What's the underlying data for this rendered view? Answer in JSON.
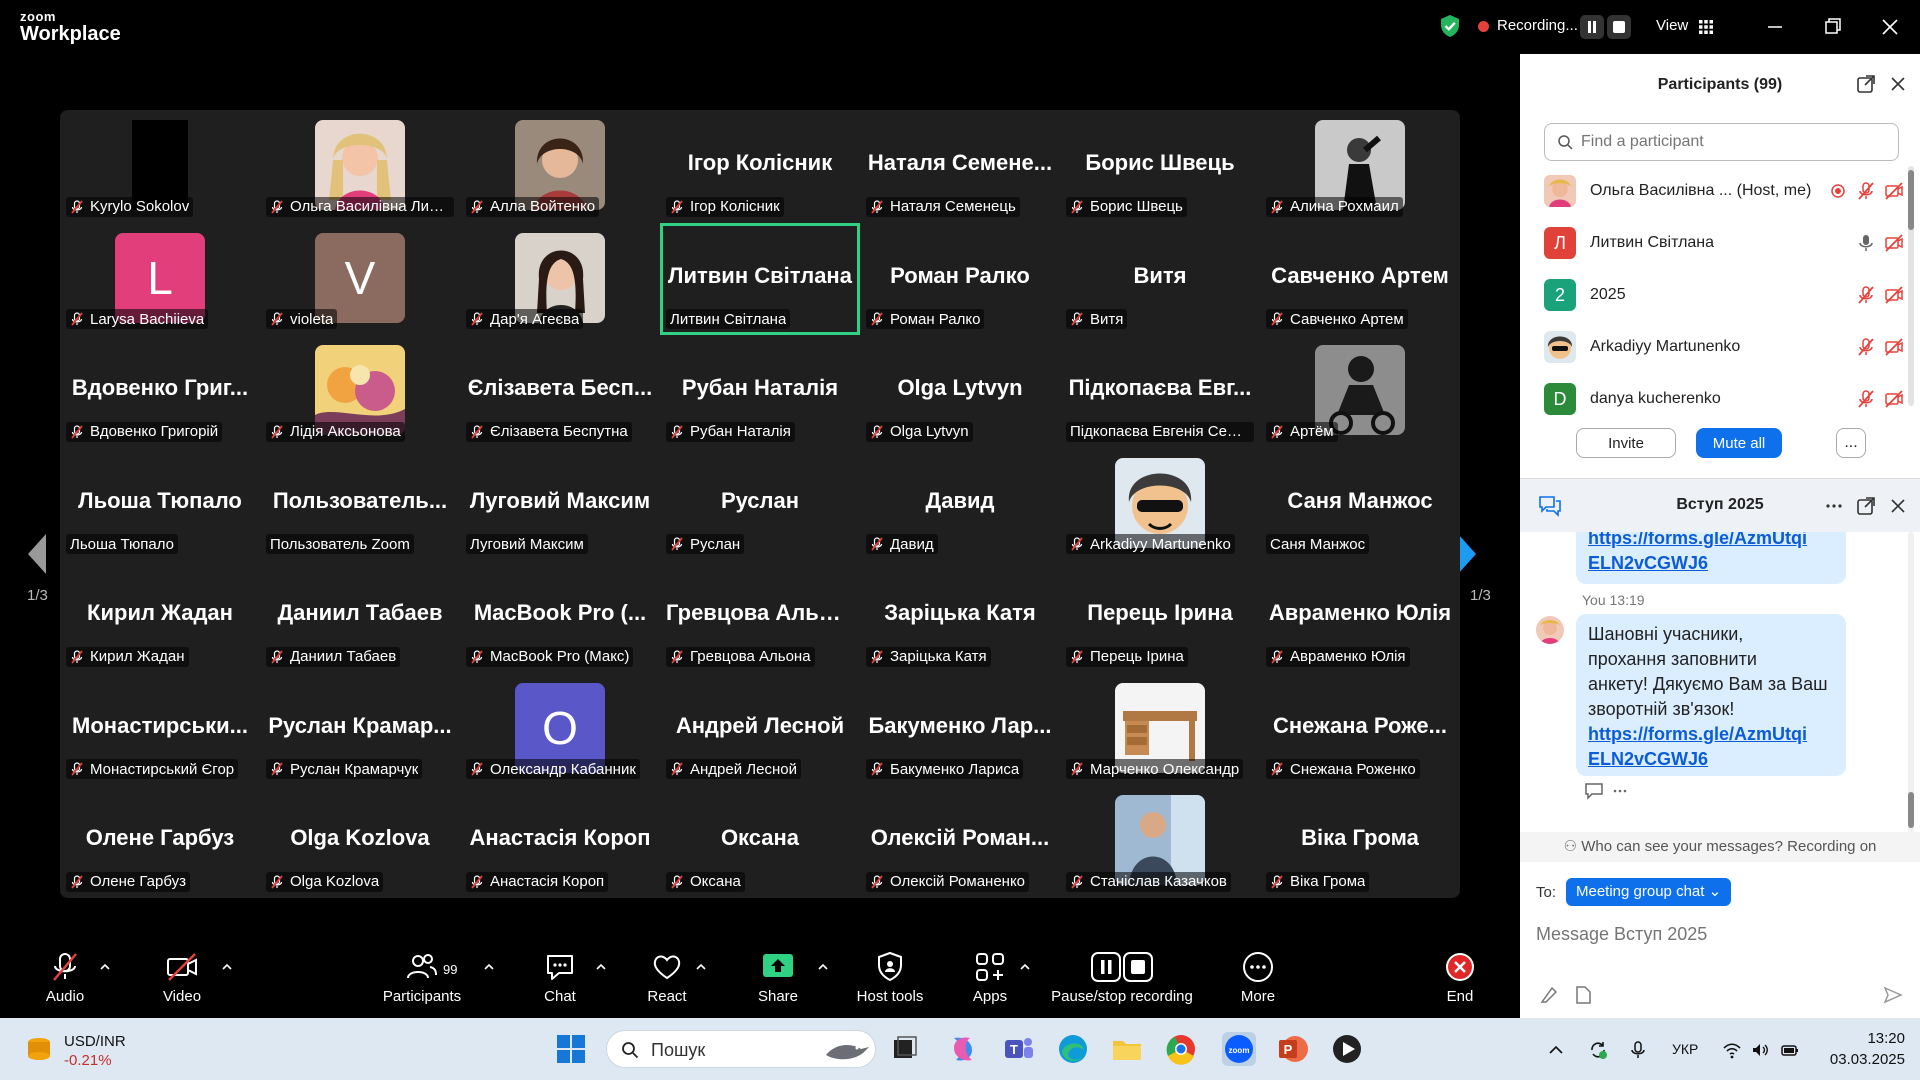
{
  "app": {
    "logo_top": "zoom",
    "logo_bottom": "Workplace"
  },
  "topbar": {
    "recording_label": "Recording...",
    "view_label": "View"
  },
  "gallery": {
    "page_indicator": "1/3",
    "tiles": [
      {
        "big": "",
        "name": "Kyrylo Sokolov",
        "avatar": "black"
      },
      {
        "big": "",
        "name": "Ольга Василівна Литв...",
        "avatar": "photo-blonde"
      },
      {
        "big": "",
        "name": "Алла Войтенко",
        "avatar": "photo-woman"
      },
      {
        "big": "Ігор Колісник",
        "name": "Ігор Колісник"
      },
      {
        "big": "Наталя Семене...",
        "name": "Наталя Семенець"
      },
      {
        "big": "Борис Швець",
        "name": "Борис Швець"
      },
      {
        "big": "",
        "name": "Алина Рохмаил",
        "avatar": "photo-dark"
      },
      {
        "big": "",
        "name": "Larysa Bachiieva",
        "letter": "L",
        "color": "#e23e7c"
      },
      {
        "big": "",
        "name": "violeta",
        "letter": "V",
        "color": "#8b6a60"
      },
      {
        "big": "",
        "name": "Дар'я Агеєва",
        "avatar": "photo-girl"
      },
      {
        "big": "Литвин Світлана",
        "name": "Литвин Світлана",
        "active": true,
        "nomic": true
      },
      {
        "big": "Роман Ралко",
        "name": "Роман Ралко"
      },
      {
        "big": "Витя",
        "name": "Витя"
      },
      {
        "big": "Савченко Артем",
        "name": "Савченко Артем"
      },
      {
        "big": "Вдовенко Григ...",
        "name": "Вдовенко Григорій"
      },
      {
        "big": "",
        "name": "Лідія Аксьонова",
        "avatar": "photo-art"
      },
      {
        "big": "Єлізавета Бесп...",
        "name": "Єлізавета Беспутна"
      },
      {
        "big": "Рубан Наталія",
        "name": "Рубан Наталія"
      },
      {
        "big": "Olga Lytvyn",
        "name": "Olga Lytvyn"
      },
      {
        "big": "Підкопаєва Евг...",
        "name": "Підкопаєва Евгенія Сергі...",
        "nomic": true
      },
      {
        "big": "",
        "name": "Артём",
        "avatar": "photo-moto"
      },
      {
        "big": "Льоша Тюпало",
        "name": "Льоша Тюпало",
        "nomic": true
      },
      {
        "big": "Пользователь...",
        "name": "Пользователь Zoom",
        "nomic": true
      },
      {
        "big": "Луговий Максим",
        "name": "Луговий Максим",
        "nomic": true
      },
      {
        "big": "Руслан",
        "name": "Руслан"
      },
      {
        "big": "Давид",
        "name": "Давид"
      },
      {
        "big": "",
        "name": "Arkadiyy Martunenko",
        "avatar": "photo-cartoon"
      },
      {
        "big": "Саня Манжос",
        "name": "Саня Манжос",
        "nomic": true
      },
      {
        "big": "Кирил Жадан",
        "name": "Кирил Жадан"
      },
      {
        "big": "Даниил Табаев",
        "name": "Даниил Табаев"
      },
      {
        "big": "MacBook Pro (...",
        "name": "MacBook Pro (Макс)"
      },
      {
        "big": "Гревцова Альона",
        "name": "Гревцова Альона"
      },
      {
        "big": "Заріцька Катя",
        "name": "Заріцька Катя"
      },
      {
        "big": "Перець Ірина",
        "name": "Перець Ірина"
      },
      {
        "big": "Авраменко Юлія",
        "name": "Авраменко Юлія"
      },
      {
        "big": "Монастирськи...",
        "name": "Монастирський Єгор"
      },
      {
        "big": "Руслан Крамар...",
        "name": "Руслан Крамарчук"
      },
      {
        "big": "",
        "name": "Олександр Кабанник",
        "letter": "О",
        "color": "#5a57c9"
      },
      {
        "big": "Андрей Лесной",
        "name": "Андрей Лесной"
      },
      {
        "big": "Бакуменко Лар...",
        "name": "Бакуменко Лариса"
      },
      {
        "big": "",
        "name": "Марченко Олександр",
        "avatar": "photo-desk"
      },
      {
        "big": "Снежана Роже...",
        "name": "Снежана Роженко"
      },
      {
        "big": "Олене Гарбуз",
        "name": "Олене Гарбуз"
      },
      {
        "big": "Olga Kozlova",
        "name": "Olga Kozlova"
      },
      {
        "big": "Анастасія Короп",
        "name": "Анастасія Короп"
      },
      {
        "big": "Оксана",
        "name": "Оксана"
      },
      {
        "big": "Олексій Роман...",
        "name": "Олексій Романенко"
      },
      {
        "big": "",
        "name": "Станіслав Казачков",
        "avatar": "photo-man"
      },
      {
        "big": "Віка Грома",
        "name": "Віка Грома"
      }
    ]
  },
  "toolbar": {
    "audio": "Audio",
    "video": "Video",
    "participants": "Participants",
    "participants_count": "99",
    "chat": "Chat",
    "react": "React",
    "share": "Share",
    "host_tools": "Host tools",
    "apps": "Apps",
    "pause_recording": "Pause/stop recording",
    "more": "More",
    "end": "End"
  },
  "participants_panel": {
    "title": "Participants (99)",
    "search_placeholder": "Find a participant",
    "list": [
      {
        "name": "Ольга Василівна ... (Host, me)",
        "avatar": "photo",
        "recording": true
      },
      {
        "name": "Литвин Світлана",
        "letter": "Л",
        "color": "#e0423a",
        "mic_on": true
      },
      {
        "name": "2025",
        "letter": "2",
        "color": "#1aa37a"
      },
      {
        "name": "Arkadiyy Martunenko",
        "avatar": "cartoon"
      },
      {
        "name": "danya kucherenko",
        "letter": "D",
        "color": "#2c8a3b"
      }
    ],
    "invite": "Invite",
    "mute_all": "Mute all",
    "more": "..."
  },
  "chat": {
    "title": "Вступ 2025",
    "prev_link_1": "https://forms.gle/AzmUtqi",
    "prev_link_2": "ELN2vCGWJ6",
    "meta": "You 13:19",
    "msg_line1": "Шановні учасники,",
    "msg_line2": "прохання заповнити",
    "msg_line3": "анкету! Дякуємо Вам за Ваш",
    "msg_line4": "зворотній зв'язок!",
    "msg_link_1": "https://forms.gle/AzmUtqi",
    "msg_link_2": "ELN2vCGWJ6",
    "who_can_see": "Who can see your messages? Recording on",
    "to_label": "To:",
    "to_value": "Meeting group chat",
    "input_placeholder": "Message Вступ 2025"
  },
  "taskbar": {
    "ticker_symbol": "USD/INR",
    "ticker_change": "-0.21%",
    "search_placeholder": "Пошук",
    "lang": "УКР",
    "time": "13:20",
    "date": "03.03.2025"
  }
}
